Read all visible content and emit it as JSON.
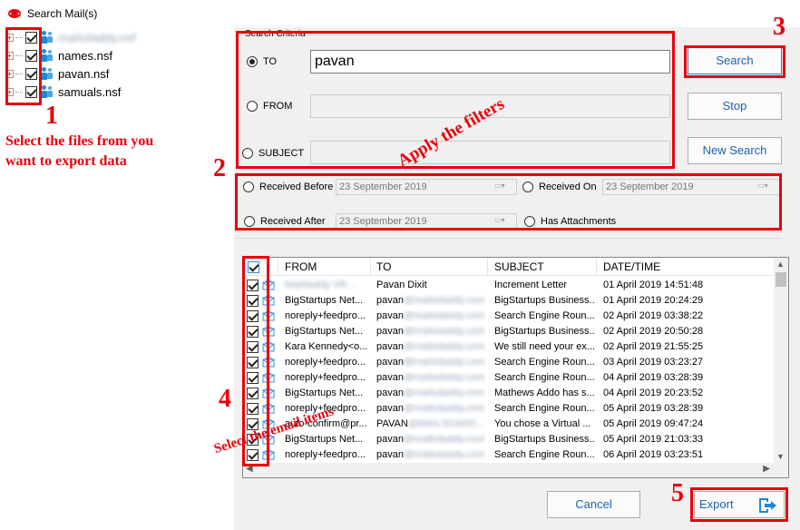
{
  "window": {
    "title": "Search Mail(s)"
  },
  "tree": [
    {
      "label": "mailsdaddy.nsf",
      "blurred": true,
      "checked": true
    },
    {
      "label": "names.nsf",
      "blurred": false,
      "checked": true
    },
    {
      "label": "pavan.nsf",
      "blurred": false,
      "checked": true
    },
    {
      "label": "samuals.nsf",
      "blurred": false,
      "checked": true
    }
  ],
  "search_criteria": {
    "legend": "Search Criteria",
    "to_label": "TO",
    "to_value": "pavan",
    "from_label": "FROM",
    "from_value": "",
    "subject_label": "SUBJECT",
    "subject_value": "",
    "selected": "TO"
  },
  "buttons": {
    "search": "Search",
    "stop": "Stop",
    "new_search": "New Search",
    "cancel": "Cancel",
    "export": "Export"
  },
  "filters": {
    "received_before": "Received Before",
    "received_before_date": "23 September 2019",
    "received_on": "Received On",
    "received_on_date": "23 September 2019",
    "received_after": "Received After",
    "received_after_date": "23 September 2019",
    "has_attachments": "Has Attachments"
  },
  "grid": {
    "columns": [
      "FROM",
      "TO",
      "SUBJECT",
      "DATE/TIME"
    ],
    "rows": [
      {
        "from": "Maildaddy VR...",
        "to": "Pavan Dixit",
        "subject": "Increment Letter",
        "date": "01 April 2019 14:51:48",
        "from_blur": true,
        "to_blur_suffix": ""
      },
      {
        "from": "BigStartups Net...",
        "to": "pavan",
        "to_blur_suffix": "@mailsdaddy.com",
        "subject": "BigStartups Business...",
        "date": "01 April 2019 20:24:29"
      },
      {
        "from": "noreply+feedpro...",
        "to": "pavan",
        "to_blur_suffix": "@mailsdaddy.com",
        "subject": "Search Engine Roun...",
        "date": "02 April 2019 03:38:22"
      },
      {
        "from": "BigStartups Net...",
        "to": "pavan",
        "to_blur_suffix": "@mailsdaddy.com",
        "subject": "BigStartups Business...",
        "date": "02 April 2019 20:50:28"
      },
      {
        "from": "Kara Kennedy<o...",
        "to": "pavan",
        "to_blur_suffix": "@mailsdaddy.com",
        "subject": "We still need your ex...",
        "date": "02 April 2019 21:55:25"
      },
      {
        "from": "noreply+feedpro...",
        "to": "pavan",
        "to_blur_suffix": "@mailsdaddy.com",
        "subject": "Search Engine Roun...",
        "date": "03 April 2019 03:23:27"
      },
      {
        "from": "noreply+feedpro...",
        "to": "pavan",
        "to_blur_suffix": "@mailsdaddy.com",
        "subject": "Search Engine Roun...",
        "date": "04 April 2019 03:28:39"
      },
      {
        "from": "BigStartups Net...",
        "to": "pavan",
        "to_blur_suffix": "@mailsdaddy.com",
        "subject": "Mathews Addo has s...",
        "date": "04 April 2019 20:23:52"
      },
      {
        "from": "noreply+feedpro...",
        "to": "pavan",
        "to_blur_suffix": "@mailsdaddy.com",
        "subject": "Search Engine Roun...",
        "date": "05 April 2019 03:28:39"
      },
      {
        "from": "auto-confirm@pr...",
        "to": "PAVAN",
        "to_blur_suffix": "@MAILSDADD...",
        "subject": "You chose a Virtual ...",
        "date": "05 April 2019 09:47:24"
      },
      {
        "from": "BigStartups Net...",
        "to": "pavan",
        "to_blur_suffix": "@mailsdaddy.com",
        "subject": "BigStartups Business...",
        "date": "05 April 2019 21:03:33"
      },
      {
        "from": "noreply+feedpro...",
        "to": "pavan",
        "to_blur_suffix": "@mailsdaddy.com",
        "subject": "Search Engine Roun...",
        "date": "06 April 2019 03:23:51"
      }
    ]
  },
  "annotations": {
    "n1": "1",
    "t1a": "Select the files from you",
    "t1b": "want to export data",
    "n2": "2",
    "t2": "Apply the filters",
    "n3": "3",
    "n4": "4",
    "t4": "Select the email items",
    "n5": "5"
  },
  "colors": {
    "annotation": "#e8000b",
    "accent": "#2a7ad5",
    "icon_blue": "#1e88d8"
  }
}
